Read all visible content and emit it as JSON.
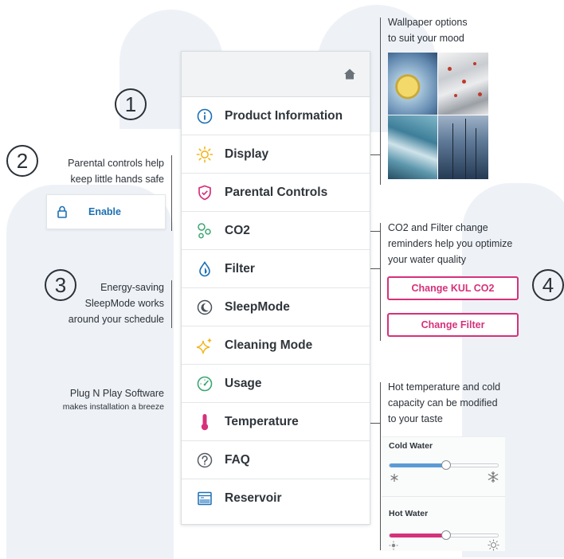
{
  "badges": [
    "1",
    "2",
    "3",
    "4"
  ],
  "callouts": {
    "wallpaper": [
      "Wallpaper options",
      "to suit your mood"
    ],
    "parental": [
      "Parental controls help",
      "keep little hands safe"
    ],
    "co2_filter": [
      "CO2 and Filter change",
      "reminders help you optimize",
      "your water quality"
    ],
    "sleep": [
      "Energy-saving",
      "SleepMode works",
      "around your schedule"
    ],
    "plug_title": "Plug N Play Software",
    "plug_sub": "makes installation a breeze",
    "temperature": [
      "Hot temperature and cold",
      "capacity can be modified",
      "to your taste"
    ]
  },
  "menu": {
    "items": [
      {
        "label": "Product Information",
        "icon": "info-icon"
      },
      {
        "label": "Display",
        "icon": "sun-icon"
      },
      {
        "label": "Parental Controls",
        "icon": "shield-icon"
      },
      {
        "label": "CO2",
        "icon": "bubbles-icon"
      },
      {
        "label": "Filter",
        "icon": "droplet-icon"
      },
      {
        "label": "SleepMode",
        "icon": "moon-icon"
      },
      {
        "label": "Cleaning Mode",
        "icon": "sparkle-icon"
      },
      {
        "label": "Usage",
        "icon": "gauge-icon"
      },
      {
        "label": "Temperature",
        "icon": "thermometer-icon"
      },
      {
        "label": "FAQ",
        "icon": "question-icon"
      },
      {
        "label": "Reservoir",
        "icon": "reservoir-icon"
      }
    ]
  },
  "parental_card": {
    "label": "Enable"
  },
  "buttons": {
    "change_co2": "Change KUL CO2",
    "change_filter": "Change Filter"
  },
  "temperature_panel": {
    "cold_label": "Cold Water",
    "cold_level": 0.52,
    "hot_label": "Hot Water",
    "hot_level": 0.52
  },
  "colors": {
    "accent_blue": "#5b9bd5",
    "brand_pink": "#d6317a",
    "link_blue": "#1d6fb3",
    "sun_yellow": "#f2b51c"
  }
}
